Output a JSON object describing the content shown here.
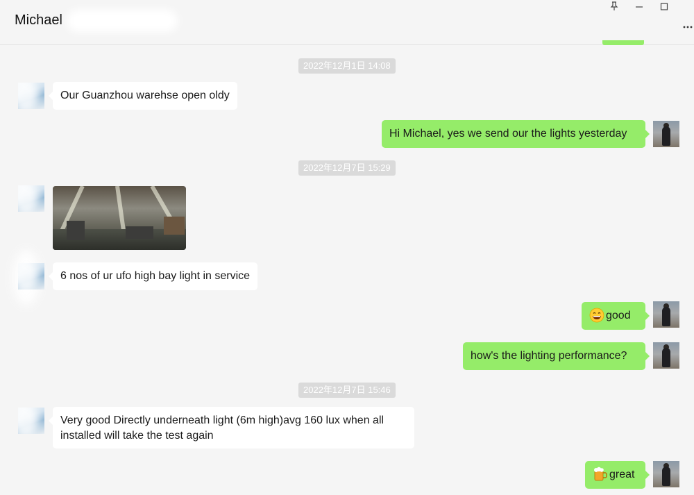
{
  "window": {
    "title": "Michael",
    "controls": {
      "pin": "pin-icon",
      "minimize": "minimize-icon",
      "maximize": "maximize-icon",
      "more": "more-icon"
    }
  },
  "colors": {
    "outgoing_bubble": "#95ec69",
    "incoming_bubble": "#ffffff",
    "timestamp_bg": "#dadada"
  },
  "timestamps": [
    "2022年12月1日 14:08",
    "2022年12月7日 15:29",
    "2022年12月7日 15:46"
  ],
  "messages": [
    {
      "side": "in",
      "text": "Our Guanzhou warehse open oldy"
    },
    {
      "side": "out",
      "text": "Hi Michael, yes we send our the lights yesterday"
    },
    {
      "side": "in",
      "type": "image",
      "image_desc": "warehouse-photo"
    },
    {
      "side": "in",
      "text": "6 nos of ur ufo high bay light in service"
    },
    {
      "side": "out",
      "emoji": "grinning-face-icon",
      "text": "good"
    },
    {
      "side": "out",
      "text": "how's the lighting performance?"
    },
    {
      "side": "in",
      "text": "Very good Directly underneath light (6m high)avg 160 lux when all installed will take the test again"
    },
    {
      "side": "out",
      "emoji": "beer-mug-icon",
      "text": "great"
    }
  ]
}
